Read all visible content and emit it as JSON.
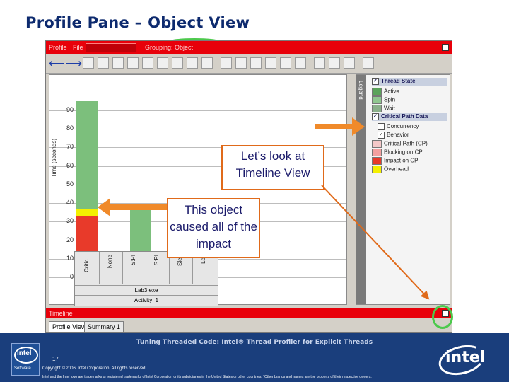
{
  "slide_title": "Profile Pane – Object View",
  "app": {
    "topbar": {
      "items": [
        "Profile",
        "File",
        "Grouping: Object"
      ]
    },
    "toolbar_icons": [
      "back-arrow-icon",
      "forward-arrow-icon",
      "filter-icon",
      "no-icon",
      "cl-icon",
      "bar-icon",
      "flag-icon",
      "export-icon",
      "doc-icon",
      "sep",
      "no-icon",
      "cl-icon",
      "close-icon",
      "settings-icon",
      "filter-icon",
      "doc-icon",
      "sep",
      "zoom-in-icon",
      "zoom-out-icon",
      "zoom-reset-icon",
      "sep",
      "help-icon"
    ],
    "chart_data": {
      "type": "bar",
      "ylabel": "Time (seconds)",
      "ylim": [
        0,
        95
      ],
      "yticks": [
        "0",
        "10",
        "20",
        "30",
        "40",
        "50",
        "60",
        "70",
        "80",
        "90"
      ],
      "categories": [
        "Critic...",
        "None",
        "S:PI",
        "S:PI",
        "Slee",
        "Lok"
      ],
      "stacks": [
        {
          "category": "Critic...",
          "segments": [
            {
              "name": "Critical Path (CP)",
              "value": 0
            },
            {
              "name": "Impact on CP",
              "value": 33
            },
            {
              "name": "Overhead",
              "value": 4
            },
            {
              "name": "Active",
              "value": 58
            }
          ]
        },
        {
          "category": "None",
          "segments": [
            {
              "name": "Active",
              "value": 1
            }
          ]
        },
        {
          "category": "S:PI",
          "segments": [
            {
              "name": "Active",
              "value": 37
            }
          ]
        },
        {
          "category": "S:PI",
          "segments": [
            {
              "name": "Active",
              "value": 1
            }
          ]
        },
        {
          "category": "Slee",
          "segments": [
            {
              "name": "Active",
              "value": 0
            }
          ]
        },
        {
          "category": "Lok",
          "segments": [
            {
              "name": "Active",
              "value": 0
            }
          ]
        }
      ],
      "group_label": "Lab3.exe",
      "sub_label": "Activity_1"
    },
    "legend": {
      "label": "Legend",
      "items": [
        {
          "type": "header",
          "label": "Thread State",
          "checked": true
        },
        {
          "type": "swatch",
          "label": "Active",
          "color": "#5aa35a"
        },
        {
          "type": "swatch",
          "label": "Spin",
          "color": "#8fc78f"
        },
        {
          "type": "swatch",
          "label": "Wait",
          "color": "#8ab08a"
        },
        {
          "type": "header",
          "label": "Critical Path Data",
          "checked": true
        },
        {
          "type": "check",
          "label": "Concurrency",
          "checked": false
        },
        {
          "type": "check",
          "label": "Behavior",
          "checked": true
        },
        {
          "type": "swatch",
          "label": "Critical Path (CP)",
          "color": "#f4c8c8"
        },
        {
          "type": "swatch",
          "label": "Blocking on CP",
          "color": "#f3a0a0"
        },
        {
          "type": "swatch",
          "label": "Impact on CP",
          "color": "#e83a2a"
        },
        {
          "type": "swatch",
          "label": "Overhead",
          "color": "#f4f000"
        }
      ]
    },
    "timeline_label": "Timeline",
    "tabs": [
      "Profile View",
      "Summary 1"
    ]
  },
  "callouts": {
    "timeline": "Let’s look at Timeline View",
    "object": "This object caused all of the impact"
  },
  "footer": {
    "title": "Tuning Threaded Code: Intel® Thread Profiler for Explicit Threads",
    "page": "17",
    "copyright": "Copyright © 2006, Intel Corporation. All rights reserved.",
    "trademark": "Intel and the Intel logo are trademarks or registered trademarks of Intel Corporation or its subsidiaries in the United States or other countries. *Other brands and names are the property of their respective owners.",
    "logo_left_text": "intel",
    "logo_left_sub": "Software",
    "logo_right_text": "intel"
  },
  "colors": {
    "title": "#0d2a6e",
    "red": "#e8000a",
    "callout_border": "#e06a1a",
    "footer": "#1a3e7c",
    "green": "#4cc94c"
  }
}
